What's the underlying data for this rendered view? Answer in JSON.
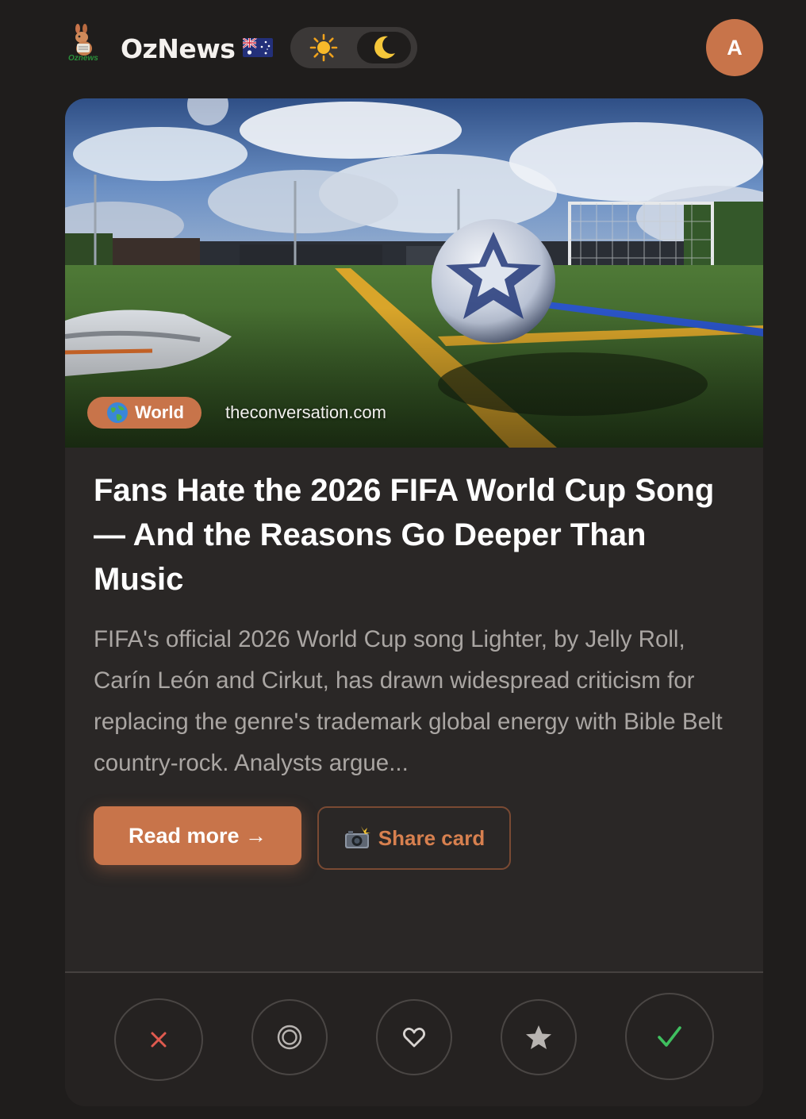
{
  "header": {
    "brand": "OzNews",
    "logo_text": "Oznews",
    "flag_icon": "australia-flag-icon",
    "theme_toggle": {
      "light_icon": "sun-icon",
      "dark_icon": "moon-icon",
      "selected": "dark"
    },
    "avatar_initial": "A"
  },
  "article": {
    "category_icon": "globe-icon",
    "category": "World",
    "source": "theconversation.com",
    "title": "Fans Hate the 2026 FIFA World Cup Song — And the Reasons Go Deeper Than Music",
    "summary": "FIFA's official 2026 World Cup song Lighter, by Jelly Roll, Carín León and Cirkut, has drawn widespread criticism for replacing the genre's trademark global energy with Bible Belt country-rock. Analysts argue...",
    "read_more_label": "Read more →",
    "share_label": "Share card",
    "share_icon": "camera-flash-icon"
  },
  "actions": [
    {
      "name": "skip",
      "icon": "close-icon",
      "color": "#e05a4f"
    },
    {
      "name": "later",
      "icon": "target-circle-icon",
      "color": "#b8b4b1"
    },
    {
      "name": "like",
      "icon": "heart-icon",
      "color": "#d8d4d1"
    },
    {
      "name": "favorite",
      "icon": "star-icon",
      "color": "#b8b4b1"
    },
    {
      "name": "done",
      "icon": "check-icon",
      "color": "#3fbf5f"
    }
  ],
  "colors": {
    "background": "#1f1d1c",
    "card": "#2a2726",
    "accent": "#c8744a",
    "text": "#ffffff",
    "muted_text": "#aaa6a3"
  }
}
